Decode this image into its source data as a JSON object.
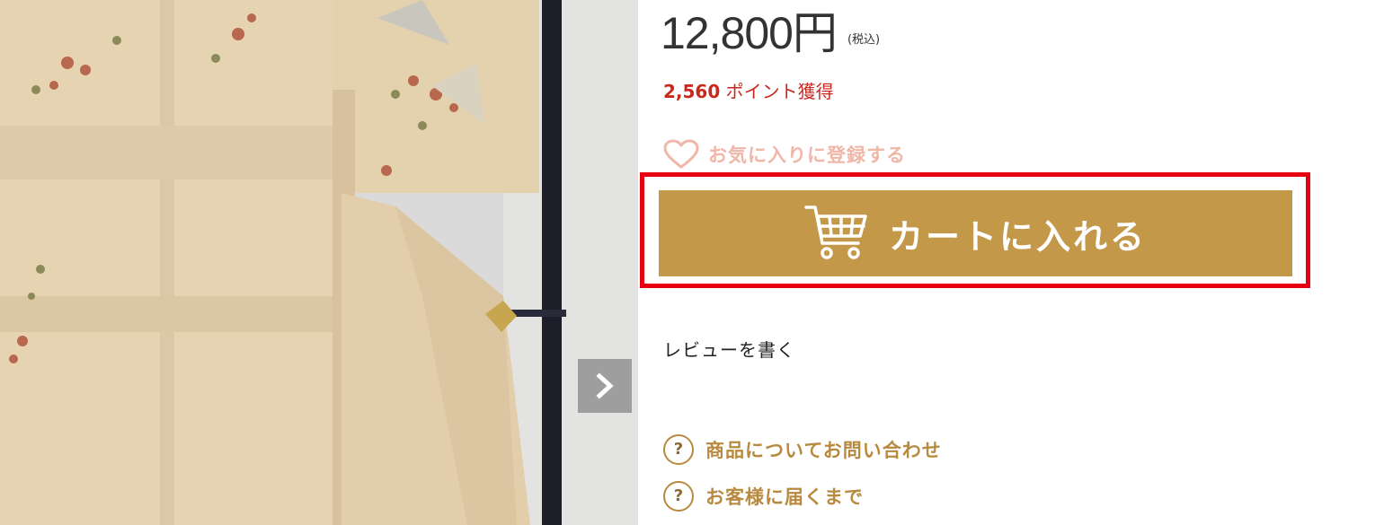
{
  "product": {
    "image_alt_icon": "kimono-photo",
    "price": "12,800円",
    "tax_note": "(税込)",
    "points_value": "2,560",
    "points_text": " ポイント獲得",
    "favorite_label": "お気に入りに登録する",
    "cart_label": "カートに入れる",
    "review_label": "レビューを書く",
    "inquiry_label": "商品についてお問い合わせ",
    "delivery_label": "お客様に届くまで",
    "help_icon_glyph": "?"
  },
  "colors": {
    "cart_button": "#c39848",
    "highlight_border": "#e60012",
    "points_text": "#c8281e",
    "favorite_text": "#f0b7a9",
    "help_text": "#b78a3f"
  },
  "icons": {
    "gallery_next": "chevron-right-icon",
    "favorite": "heart-icon",
    "cart": "shopping-cart-icon",
    "help": "question-circle-icon"
  }
}
